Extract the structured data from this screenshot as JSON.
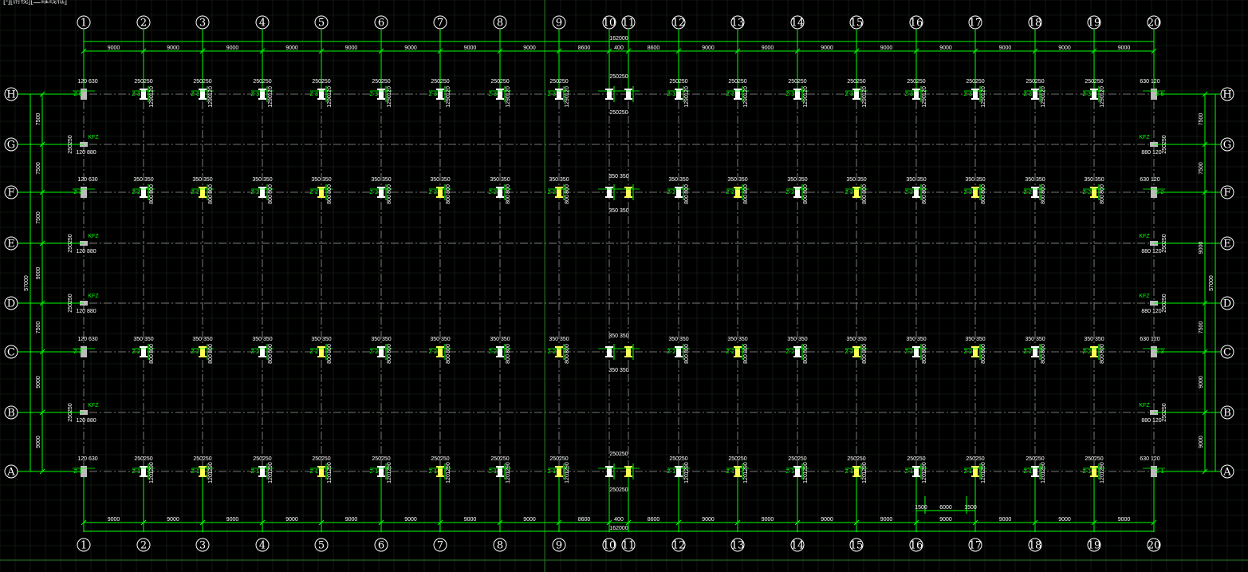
{
  "view_label": "[-][俯视][二维线框]",
  "column_axes": {
    "labels": [
      "1",
      "2",
      "3",
      "4",
      "5",
      "6",
      "7",
      "8",
      "9",
      "10",
      "11",
      "12",
      "13",
      "14",
      "15",
      "16",
      "17",
      "18",
      "19",
      "20"
    ]
  },
  "row_axes": {
    "labels": [
      "H",
      "G",
      "F",
      "E",
      "D",
      "C",
      "B",
      "A"
    ]
  },
  "dimensions": {
    "total_width": "162000",
    "spans_top": [
      "9000",
      "9000",
      "9000",
      "9000",
      "9000",
      "9000",
      "9000",
      "9000",
      "8600",
      "400",
      "8600",
      "9000",
      "9000",
      "9000",
      "9000",
      "9000",
      "9000",
      "9000",
      "9000"
    ],
    "spans_bottom": [
      "9000",
      "9000",
      "9000",
      "9000",
      "9000",
      "9000",
      "9000",
      "9000",
      "8600",
      "400",
      "8600",
      "9000",
      "9000",
      "9000",
      "9000",
      "9000",
      "9000",
      "9000",
      "9000"
    ],
    "total_height": "57000",
    "spans_left": [
      "7500",
      "7500",
      "7500",
      "9000",
      "7500",
      "9000",
      "9000"
    ],
    "spans_right": [
      "7500",
      "7500",
      "9000",
      "7500",
      "9000",
      "9000"
    ],
    "detail": [
      "1500",
      "6000",
      "1500"
    ]
  },
  "column_labels": {
    "row_H": {
      "size": "250250",
      "name": "Z-3",
      "dims": [
        "120",
        "1290"
      ],
      "end_size_left": "120 630",
      "end_size_right": "630 120",
      "end_name": "Z-5",
      "mid_size": "250250"
    },
    "row_F": {
      "size": "350 350",
      "name": "Z-2",
      "dims": [
        "800",
        "800"
      ],
      "end_size_left": "120 630",
      "end_size_right": "630 120",
      "end_name": "Z-2",
      "mid_size": "350 350"
    },
    "row_C": {
      "size": "350 350",
      "name": "Z-2",
      "dims": [
        "800",
        "800"
      ],
      "end_size_left": "120 630",
      "end_size_right": "630 120",
      "end_name": "Z-3",
      "mid_size": "350 350"
    },
    "row_A": {
      "size": "250250",
      "name": "Z-1",
      "dims": [
        "1290",
        "120"
      ],
      "end_size_left": "120 630",
      "end_size_right": "630 120",
      "end_name": "Z-1",
      "mid_size": "250250"
    },
    "wind_column": {
      "name": "KFZ",
      "size": "250250",
      "size2_left": "120 880",
      "size2_right": "880 120"
    }
  }
}
